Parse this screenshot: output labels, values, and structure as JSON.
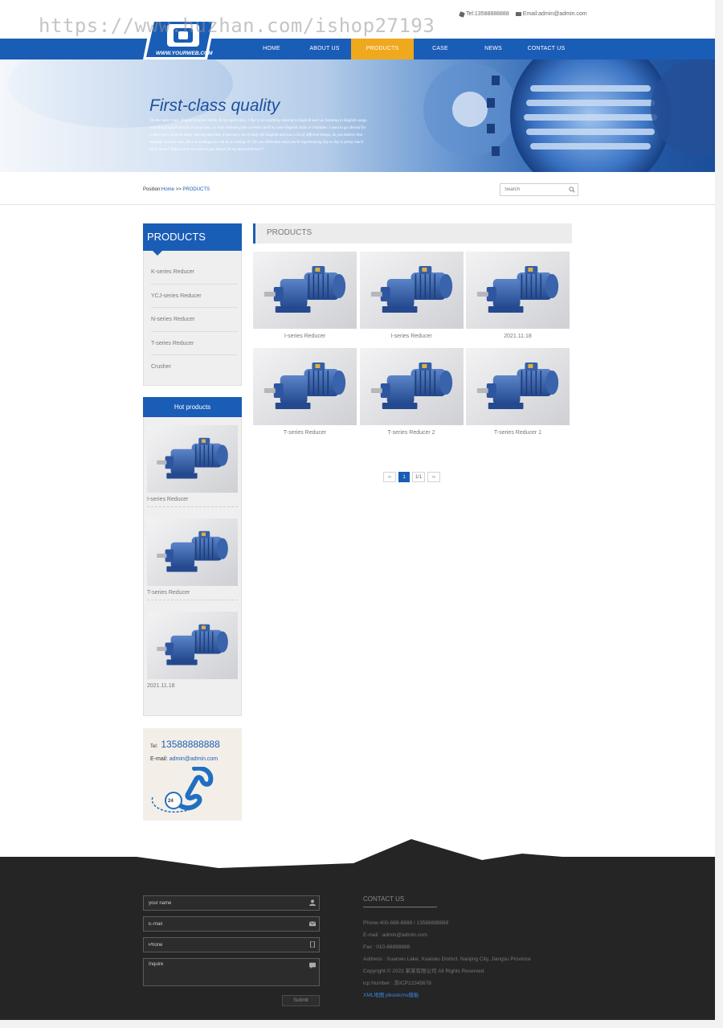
{
  "watermark": "https://www.huzhan.com/ishop27193",
  "top": {
    "tel": "Tel:13588888888",
    "email": "Email:admin@admin.com"
  },
  "logo": {
    "text": "WWW.YOURWEB.COM"
  },
  "nav": [
    {
      "label": "HOME"
    },
    {
      "label": "ABOUT US"
    },
    {
      "label": "PRODUCTS"
    },
    {
      "label": "CASE"
    },
    {
      "label": "NEWS"
    },
    {
      "label": "CONTACT US"
    }
  ],
  "banner": {
    "title": "First-class quality",
    "text": "On the same stage, English teacher labels. In my spare time, I like to do anything relating to English such as listening to English songs, watching English movies or programs, or even attending the activities held by some English clubs or institutes. I used to go abroad for a short-term English study. During that time, I learned a lot of daily life English and saw a lot of different things. So you believe that nothing can beat that, there is nothing you can do to change it? Do you think that what you're experiencing day to day is pretty much set in stone? What you're not able to get ahead, let my beyond forever?"
  },
  "breadcrumb": {
    "prefix": "Position:",
    "home": "Home",
    "sep": " >> ",
    "current": "PRODUCTS"
  },
  "search": {
    "placeholder": "Search"
  },
  "sidebar": {
    "title": "PRODUCTS",
    "items": [
      "K-series Reducer",
      "YCJ-series Reducer",
      "N-series Reducer",
      "T-series Reducer",
      "Crusher"
    ]
  },
  "hot": {
    "title": "Hot products",
    "items": [
      "I-series Reducer",
      "T-series Reducer",
      "2021.11.18"
    ]
  },
  "contact_card": {
    "tel_label": "Tel:",
    "tel": "13588888888",
    "mail_label": "E-mail:",
    "mail": "admin@admin.com"
  },
  "main": {
    "title": "PRODUCTS",
    "products": [
      "I-series Reducer",
      "I-series Reducer",
      "2021.11.18",
      "T-series Reducer",
      "T-series Reducer 2",
      "T-series Reducer 1"
    ]
  },
  "pager": {
    "first": "‹‹",
    "current": "1",
    "last": "››",
    "pages": "1/1"
  },
  "footer_form": {
    "name_placeholder": "your name",
    "email_placeholder": "E-mail",
    "phone_placeholder": "Phone",
    "inquire_placeholder": "Inquire",
    "submit": "Submit"
  },
  "footer_contact": {
    "title": "CONTACT US",
    "phone": "Phone:400-888-8888 / 13588888888",
    "email": "E-mail : admin@admin.com",
    "fax": "Fax : 010-88888888",
    "address": "Address : Xuanwu Lake, Xuanwu District, Nanjing City, Jiangsu Province",
    "copyright": "Copyright © 2022 某某有限公司 All Rights Reserved.",
    "icp": "icp Number : 苏ICP12345678",
    "links": "XML地图 pbootcms模板"
  },
  "colors": {
    "brand": "#1a5db6",
    "active": "#f0a81d",
    "footer": "#252525"
  }
}
